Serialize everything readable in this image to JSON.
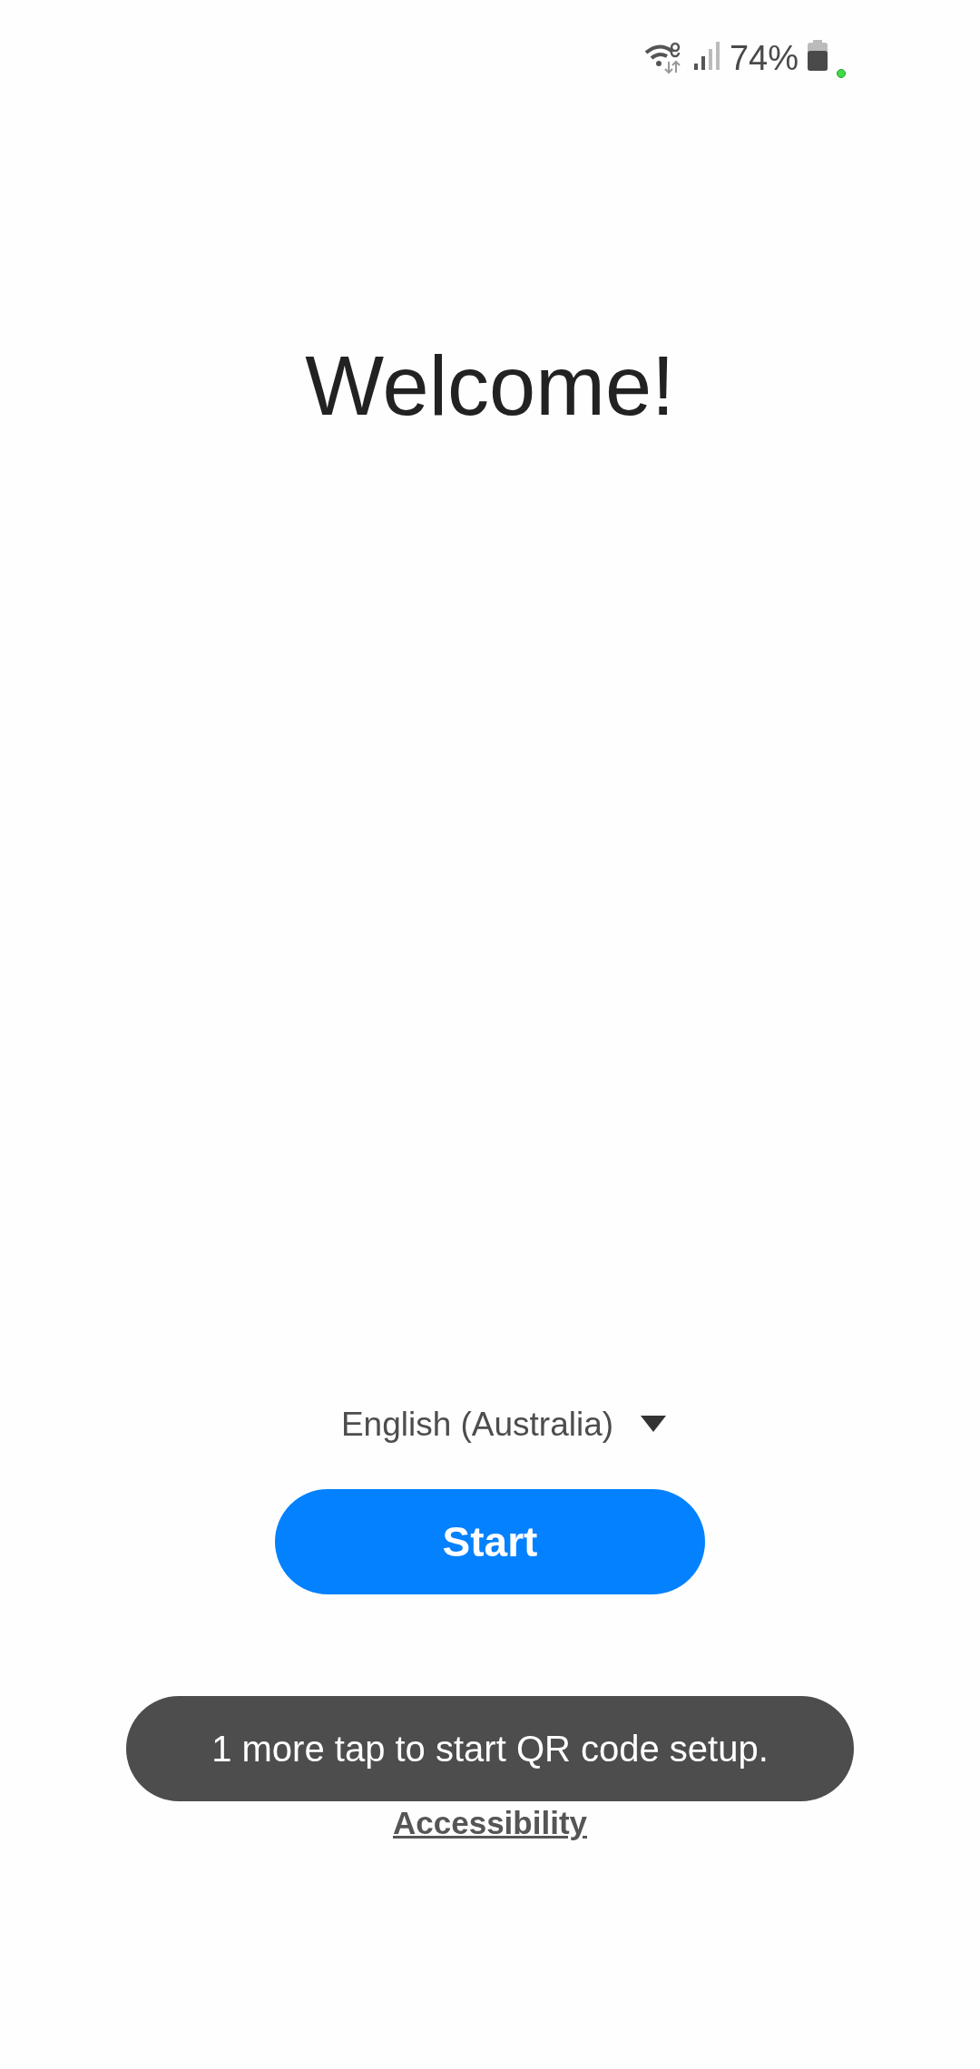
{
  "status_bar": {
    "battery_text": "74%",
    "charging": true
  },
  "title": "Welcome!",
  "language": {
    "label": "English (Australia)"
  },
  "start_button": {
    "label": "Start"
  },
  "accessibility_link": {
    "label": "Accessibility"
  },
  "toast": {
    "text": "1 more tap to start QR code setup."
  }
}
